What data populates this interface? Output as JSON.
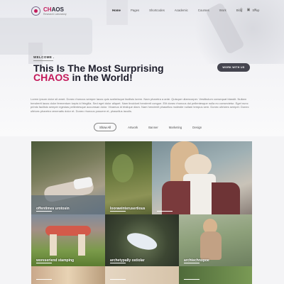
{
  "brand": {
    "name_accent": "CH",
    "name_rest": "AOS",
    "tagline": "Research Laboratory"
  },
  "nav": {
    "items": [
      "Home",
      "Pages",
      "Shortcodes",
      "Academic",
      "Courses",
      "Work",
      "Blog",
      "Shop"
    ],
    "active": "Home",
    "icons": [
      "search-icon",
      "cart-icon",
      "menu-icon"
    ]
  },
  "hero": {
    "kicker": "WELCOME .",
    "headline_line1": "This Is The Most  Surprising",
    "headline_accent": "CHAOS",
    "headline_rest": " in the World!",
    "cta_label": "WORK WITH US",
    "paragraph": "Lorem ipsum dolor sit amet. Donec rhoncus semper lacus quis scelerisque facilisis lorem. Nam pharetra a ante. Quisque ullamcorper. Vestibulum consequat blandit. Nullam hendrerit lacus dolor fermentum turpis id fringilla. Sed eget dolor aliquet. Nam tincidunt hendrerit congue. Elit donec rhoncus dui pellentesque nulla eu consectetur. Eget nunc primis facilisis semper egestas pellentesque accumsan dolor. Vivamus id tristique diam. Nam hendrerit phasellus molestie nullam tempus sem. Donec ultricies semper. Donec ultrices pharetra venenatis dolor et. Donec rhoncus posuere et, phasellus iaculis."
  },
  "filters": {
    "items": [
      "Show All",
      "Artwork",
      "Banner",
      "Marketing",
      "Design"
    ],
    "active": "Show All"
  },
  "portfolio": {
    "tiles": [
      {
        "label": "offentimes urotosin"
      },
      {
        "label": "Ioorawinterusertious"
      },
      {
        "label": ""
      },
      {
        "label": "woreseriend stamping"
      },
      {
        "label": "archetypally ostiolar"
      },
      {
        "label": "archtechnopoe"
      },
      {
        "label": ""
      },
      {
        "label": ""
      },
      {
        "label": ""
      }
    ]
  },
  "colors": {
    "accent": "#c41a5b",
    "button": "#45454f"
  }
}
